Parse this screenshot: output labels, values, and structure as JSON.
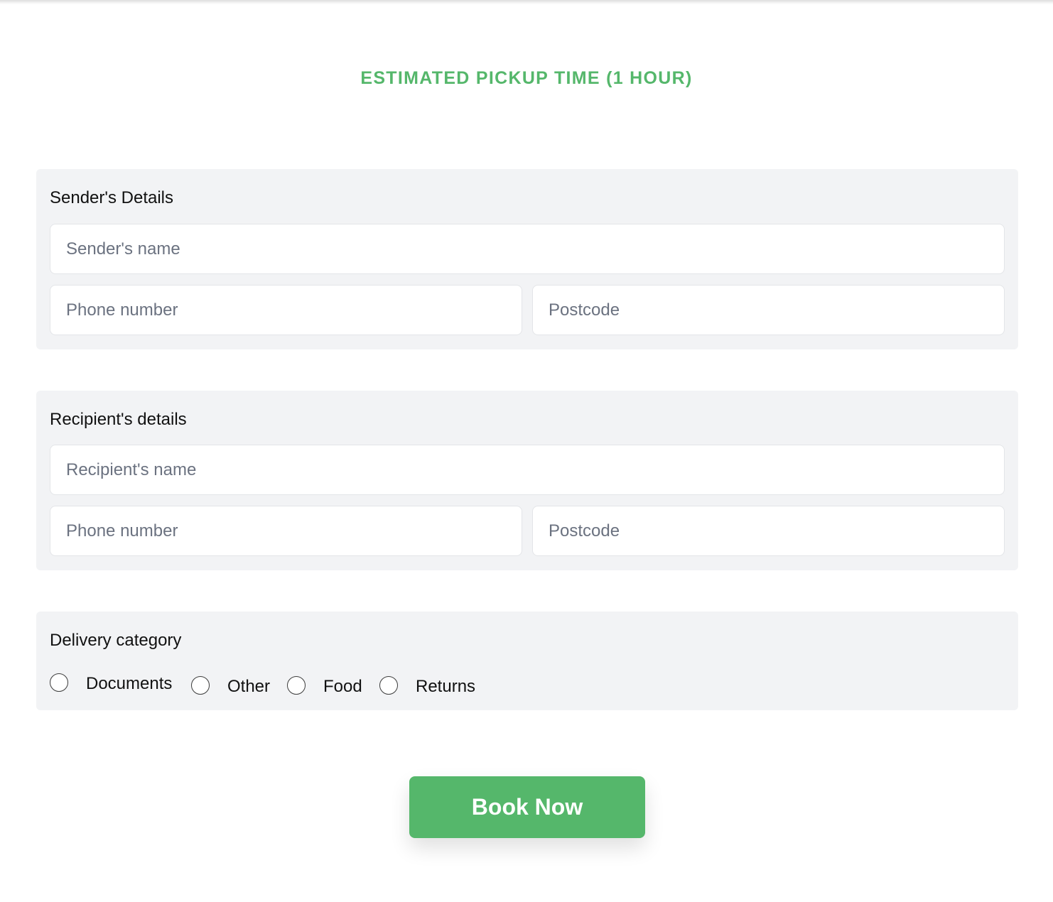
{
  "header": {
    "title": "ESTIMATED PICKUP TIME (1 HOUR)"
  },
  "sender": {
    "title": "Sender's Details",
    "name_placeholder": "Sender's name",
    "phone_placeholder": "Phone number",
    "postcode_placeholder": "Postcode"
  },
  "recipient": {
    "title": "Recipient's details",
    "name_placeholder": "Recipient's name",
    "phone_placeholder": "Phone number",
    "postcode_placeholder": "Postcode"
  },
  "delivery": {
    "title": "Delivery category",
    "options": [
      {
        "label": "Documents",
        "selected": false
      },
      {
        "label": "Other",
        "selected": false
      },
      {
        "label": "Food",
        "selected": false
      },
      {
        "label": "Returns",
        "selected": false
      }
    ]
  },
  "actions": {
    "book_label": "Book Now"
  },
  "colors": {
    "accent": "#55b76b",
    "panel_bg": "#f2f3f5"
  }
}
